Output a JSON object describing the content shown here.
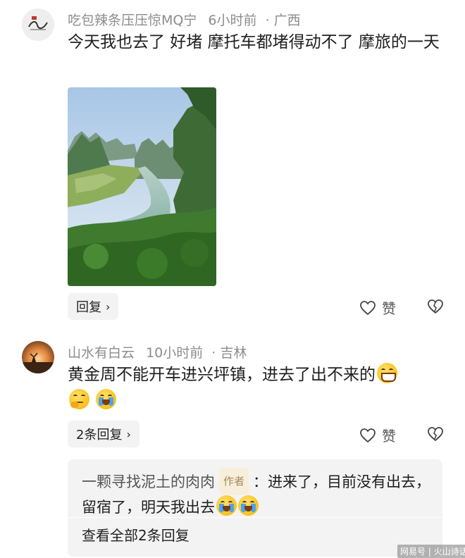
{
  "comments": [
    {
      "username": "吃包辣条压压惊MQ宁",
      "time": "6小时前",
      "location": "广西",
      "text": "今天我也去了  好堵   摩托车都堵得动不了  摩旅的一天",
      "reply_label": "回复",
      "like_label": "赞"
    },
    {
      "username": "山水有白云",
      "time": "10小时前",
      "location": "吉林",
      "text": "黄金周不能开车进兴坪镇，进去了出不来的",
      "reply_label": "2条回复",
      "like_label": "赞",
      "reply": {
        "username": "一颗寻找泥土的肉肉",
        "tag": "作者",
        "text": "：进来了，目前没有出去，留宿了，明天我出去",
        "view_all_label": "查看全部2条回复"
      }
    }
  ],
  "icons": {
    "like": "heart-icon",
    "dislike": "broken-heart-icon",
    "chevron": "chevron-right-icon"
  },
  "watermark": "网易号 | 火山诗话"
}
